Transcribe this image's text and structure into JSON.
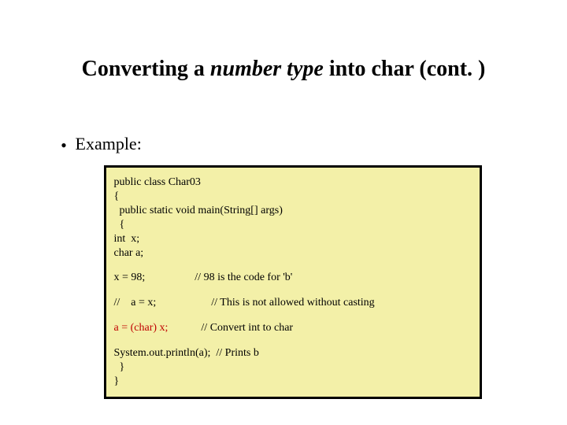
{
  "title": {
    "pre": "Converting a ",
    "italic": "number type",
    "post": " into char (cont. )"
  },
  "bullet": {
    "symbol": "•",
    "text": "Example:"
  },
  "code": {
    "l01": " public class Char03",
    "l02": " {",
    "l03": "   public static void main(String[] args)",
    "l04": "   {",
    "l05": " int  x;",
    "l06": " char a;",
    "l07": " x = 98;                  // 98 is the code for 'b'",
    "l08": " //    a = x;                    // This is not allowed without casting",
    "l09a": " a = (char) x;",
    "l09b": "            // Convert int to char",
    "l10": " System.out.println(a);  // Prints b",
    "l11": "   }",
    "l12": " }"
  }
}
